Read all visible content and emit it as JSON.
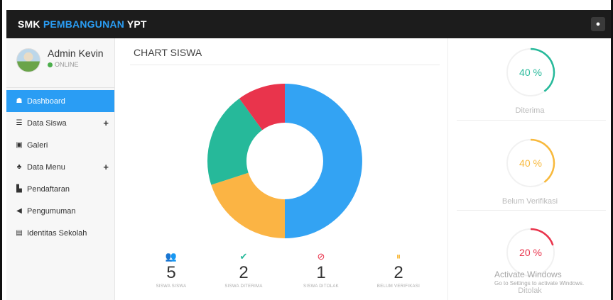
{
  "header": {
    "brand_part1": "SMK ",
    "brand_part2": "PEMBANGUNAN",
    "brand_part3": " YPT",
    "settings_icon": "gear-icon",
    "settings_glyph": "●"
  },
  "user": {
    "name": "Admin Kevin",
    "status": "ONLINE"
  },
  "sidebar": {
    "items": [
      {
        "label": "Dashboard",
        "icon": "home-icon",
        "glyph": "☗",
        "active": true
      },
      {
        "label": "Data Siswa",
        "icon": "list-icon",
        "glyph": "☰",
        "has_submenu": true
      },
      {
        "label": "Galeri",
        "icon": "image-icon",
        "glyph": "▣"
      },
      {
        "label": "Data Menu",
        "icon": "sitemap-icon",
        "glyph": "♣",
        "has_submenu": true
      },
      {
        "label": "Pendaftaran",
        "icon": "file-icon",
        "glyph": "▙"
      },
      {
        "label": "Pengumuman",
        "icon": "bullhorn-icon",
        "glyph": "◀"
      },
      {
        "label": "Identitas Sekolah",
        "icon": "id-card-icon",
        "glyph": "▤"
      }
    ],
    "plus_glyph": "+"
  },
  "main": {
    "chart_title": "CHART SISWA",
    "stats": [
      {
        "value": "5",
        "label": "SISWA SISWA",
        "icon": "users-icon",
        "glyph": "👥",
        "color": "#2a9df4"
      },
      {
        "value": "2",
        "label": "SISWA DITERIMA",
        "icon": "check-circle-icon",
        "glyph": "✔",
        "color": "#26b99a"
      },
      {
        "value": "1",
        "label": "SISWA DITOLAK",
        "icon": "ban-icon",
        "glyph": "⊘",
        "color": "#e9344c"
      },
      {
        "value": "2",
        "label": "BELUM VERIFIKASI",
        "icon": "pause-circle-icon",
        "glyph": "⏸",
        "color": "#f8b93c"
      }
    ]
  },
  "chart_data": {
    "type": "pie",
    "title": "",
    "slices": [
      {
        "value": 50,
        "color": "#33a3f3"
      },
      {
        "value": 20,
        "color": "#fbb444"
      },
      {
        "value": 20,
        "color": "#26b99a"
      },
      {
        "value": 10,
        "color": "#e9344c"
      }
    ]
  },
  "gauges": [
    {
      "value": 40,
      "text": "40 %",
      "label": "Diterima",
      "color": "#26b99a"
    },
    {
      "value": 40,
      "text": "40 %",
      "label": "Belum Verifikasi",
      "color": "#f8b93c"
    },
    {
      "value": 20,
      "text": "20 %",
      "label": "Ditolak",
      "color": "#e9344c"
    }
  ],
  "watermark": {
    "line1": "Activate Windows",
    "line2": "Go to Settings to activate Windows."
  }
}
